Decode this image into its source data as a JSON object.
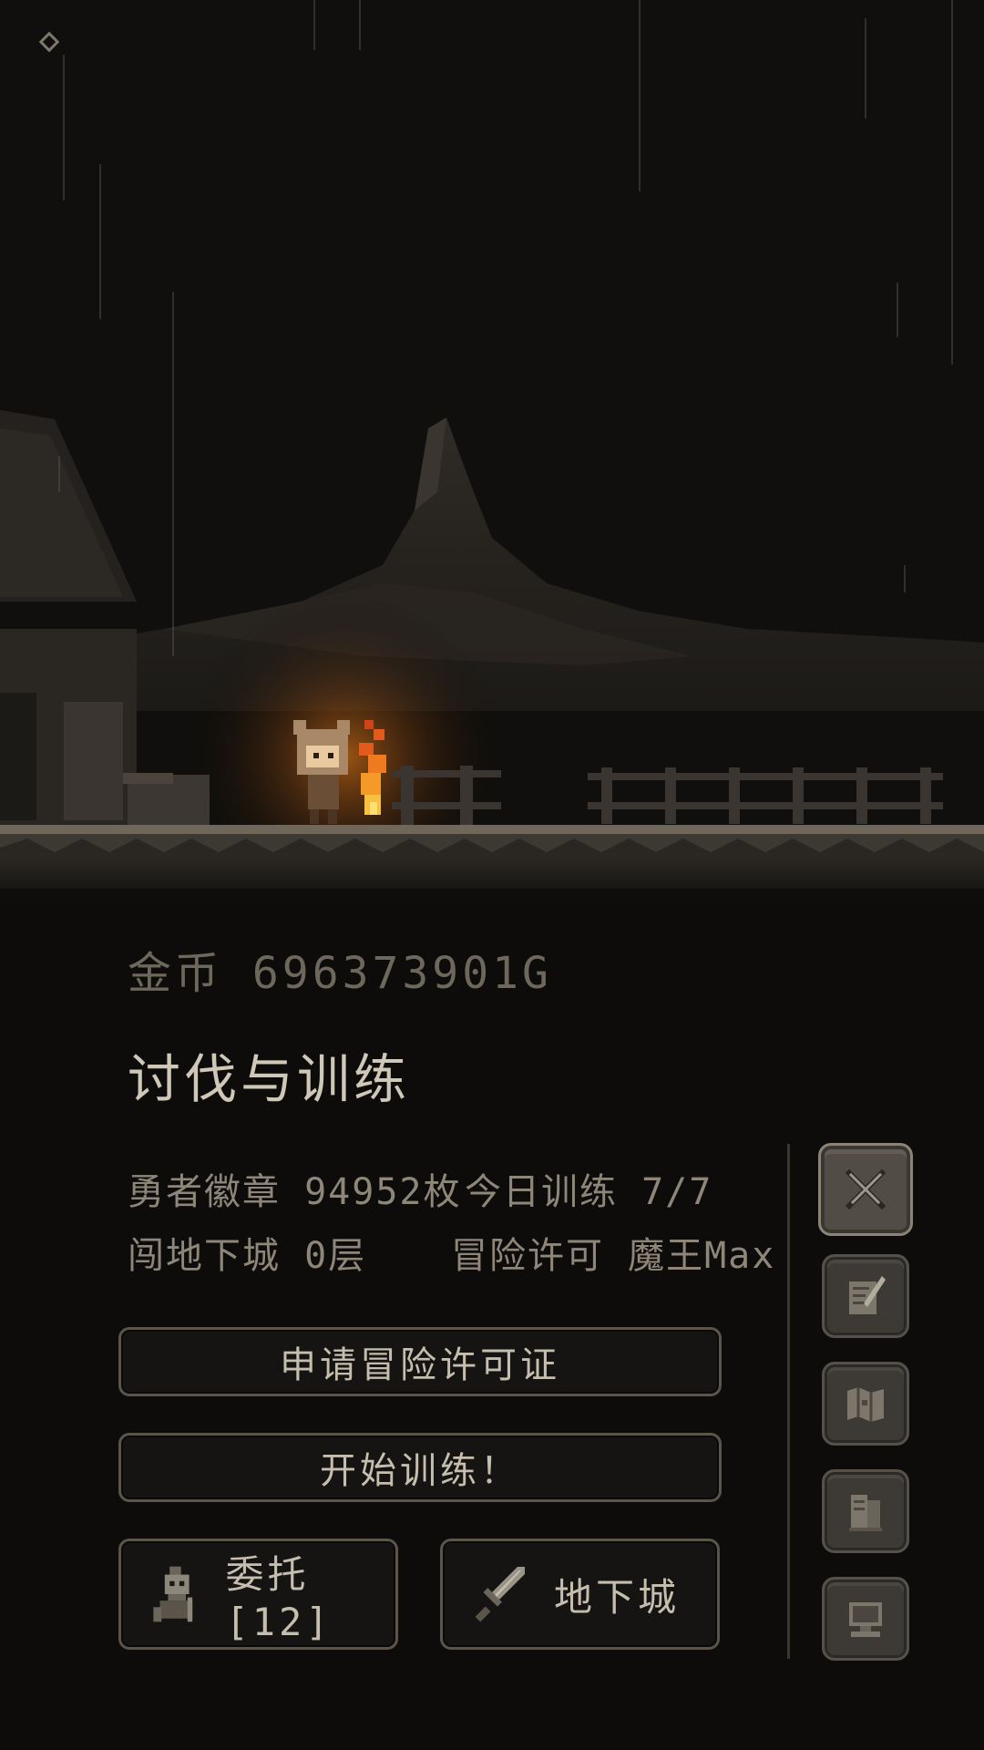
{
  "hud": {
    "settings_icon": "diamond-settings-icon"
  },
  "scene": {
    "ambient": "night-rain",
    "colors": {
      "sky": "#0f0e0d",
      "ground": "#5e574c",
      "fire": "#f08a1c"
    }
  },
  "panel": {
    "gold": "金币 696373901G",
    "title": "讨伐与训练",
    "badge": "勇者徽章 94952枚",
    "training": "今日训练 7/7",
    "dungeon_floor": "闯地下城 0层",
    "license": "冒险许可 魔王Max"
  },
  "buttons": {
    "apply_license": "申请冒险许可证",
    "start_training": "开始训练！",
    "commission": "委托[12]",
    "dungeon": "地下城"
  },
  "side_menu": [
    {
      "icon": "crossed-swords-icon",
      "active": true
    },
    {
      "icon": "quill-scroll-icon",
      "active": false
    },
    {
      "icon": "map-icon",
      "active": false
    },
    {
      "icon": "books-icon",
      "active": false
    },
    {
      "icon": "computer-icon",
      "active": false
    }
  ]
}
